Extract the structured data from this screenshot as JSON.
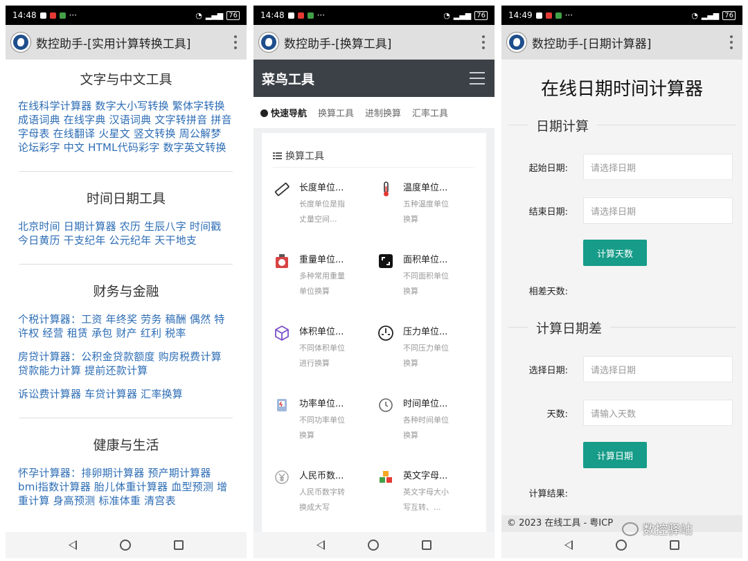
{
  "status_bars": [
    {
      "time": "14:48",
      "battery": "76"
    },
    {
      "time": "14:48",
      "battery": "76"
    },
    {
      "time": "14:49",
      "battery": "76"
    }
  ],
  "phone1": {
    "app_title": "数控助手-[实用计算转换工具]",
    "sections": [
      {
        "heading": "文字与中文工具",
        "lines": [
          "在线科学计算器 数字大小写转换 繁体字转换 成语词典 在线字典 汉语词典 文字转拼音 拼音字母表 在线翻译 火星文 竖文转换 周公解梦 论坛彩字 中文 HTML代码彩字 数字英文转换"
        ]
      },
      {
        "heading": "时间日期工具",
        "lines": [
          "北京时间 日期计算器 农历 生辰八字 时间戳 今日黄历 干支纪年 公元纪年 天干地支"
        ]
      },
      {
        "heading": "财务与金融",
        "lines": [
          "个税计算器：工资 年终奖 劳务 稿酬 偶然 特许权 经营 租赁 承包 财产 红利 税率",
          "房贷计算器：公积金贷款额度 购房税费计算 贷款能力计算 提前还款计算",
          "诉讼费计算器 车贷计算器 汇率换算"
        ]
      },
      {
        "heading": "健康与生活",
        "lines": [
          "怀孕计算器：排卵期计算器 预产期计算器 bmi指数计算器 胎儿体重计算器 血型预测 增重计算 身高预测 标准体重 清宫表"
        ]
      }
    ]
  },
  "phone2": {
    "app_title": "数控助手-[换算工具]",
    "brand": "菜鸟工具",
    "tabs": [
      "快速导航",
      "换算工具",
      "进制换算",
      "汇率工具"
    ],
    "card_title": "换算工具",
    "items": [
      {
        "title": "长度单位...",
        "desc": "长度单位是指丈量空间...",
        "icon": "ruler-icon"
      },
      {
        "title": "温度单位...",
        "desc": "五种温度单位换算",
        "icon": "thermometer-icon"
      },
      {
        "title": "重量单位...",
        "desc": "多种常用重量单位换算",
        "icon": "scale-icon"
      },
      {
        "title": "面积单位...",
        "desc": "不同面积单位换算",
        "icon": "area-icon"
      },
      {
        "title": "体积单位...",
        "desc": "不同体积单位进行换算",
        "icon": "cube-icon"
      },
      {
        "title": "压力单位...",
        "desc": "不同压力单位换算",
        "icon": "gauge-icon"
      },
      {
        "title": "功率单位...",
        "desc": "不同功率单位换算",
        "icon": "power-icon"
      },
      {
        "title": "时间单位...",
        "desc": "各种时间单位换算",
        "icon": "clock-icon"
      },
      {
        "title": "人民币数...",
        "desc": "人民币数字转换成大写",
        "icon": "yuan-icon"
      },
      {
        "title": "英文字母...",
        "desc": "英文字母大小写互转、...",
        "icon": "blocks-icon"
      }
    ]
  },
  "phone3": {
    "app_title": "数控助手-[日期计算器]",
    "page_title": "在线日期时间计算器",
    "section1": {
      "legend": "日期计算",
      "start_label": "起始日期:",
      "start_placeholder": "请选择日期",
      "end_label": "结束日期:",
      "end_placeholder": "请选择日期",
      "button": "计算天数",
      "result_label": "相差天数:"
    },
    "section2": {
      "legend": "计算日期差",
      "date_label": "选择日期:",
      "date_placeholder": "请选择日期",
      "days_label": "天数:",
      "days_placeholder": "请输入天数",
      "button": "计算日期",
      "result_label": "计算结果:"
    },
    "footer": "© 2023 在线工具 - 粤ICP"
  },
  "watermark": "数控驿站"
}
